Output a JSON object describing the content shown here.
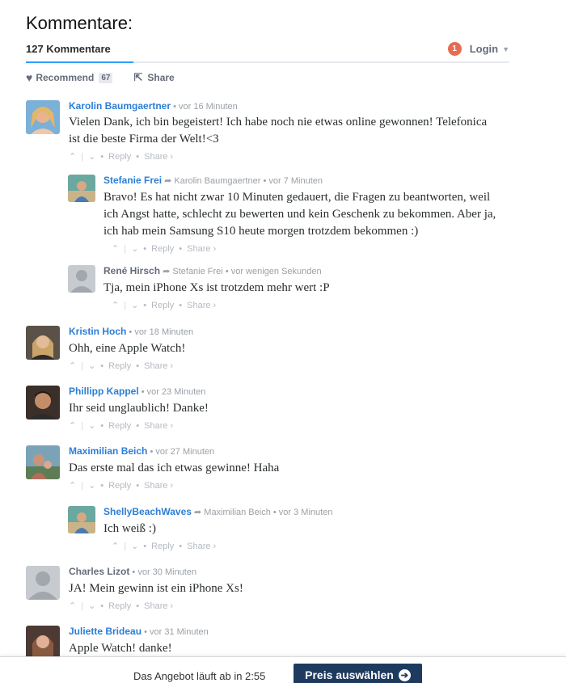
{
  "header": {
    "title": "Kommentare:",
    "count_label": "127 Kommentare",
    "notif_count": "1",
    "login_label": "Login",
    "recommend_label": "Recommend",
    "recommend_count": "67",
    "share_label": "Share"
  },
  "actions": {
    "reply": "Reply",
    "share": "Share ›",
    "up": "⌃",
    "down": "⌄"
  },
  "comments": [
    {
      "author": "Karolin Baumgaertner",
      "reply_to": "",
      "time": "• vor 16 Minuten",
      "line1": "Vielen Dank, ich bin begeistert! Ich habe noch nie etwas online gewonnen! Telefonica",
      "line2": "ist die beste Firma der Welt!<3",
      "line3": ""
    },
    {
      "author": "Stefanie Frei",
      "reply_to": "Karolin Baumgaertner",
      "time": "• vor 7 Minuten",
      "line1": "Bravo! Es hat nicht zwar 10 Minuten gedauert, die Fragen zu beantworten, weil",
      "line2": "ich Angst hatte, schlecht zu bewerten und kein Geschenk zu bekommen. Aber ja,",
      "line3": "ich hab mein Samsung S10 heute morgen trotzdem bekommen :)"
    },
    {
      "author": "René Hirsch",
      "reply_to": "Stefanie Frei",
      "time": "• vor wenigen Sekunden",
      "line1": "Tja, mein iPhone Xs ist trotzdem mehr wert :P",
      "line2": "",
      "line3": ""
    },
    {
      "author": "Kristin Hoch",
      "reply_to": "",
      "time": "• vor 18 Minuten",
      "line1": "Ohh, eine Apple Watch!",
      "line2": "",
      "line3": ""
    },
    {
      "author": "Phillipp Kappel",
      "reply_to": "",
      "time": "• vor 23 Minuten",
      "line1": "Ihr seid unglaublich! Danke!",
      "line2": "",
      "line3": ""
    },
    {
      "author": "Maximilian Beich",
      "reply_to": "",
      "time": "• vor 27 Minuten",
      "line1": "Das erste mal das ich etwas gewinne! Haha",
      "line2": "",
      "line3": ""
    },
    {
      "author": "ShellyBeachWaves",
      "reply_to": "Maximilian Beich",
      "time": "• vor 3 Minuten",
      "line1": "Ich weiß :)",
      "line2": "",
      "line3": ""
    },
    {
      "author": "Charles Lizot",
      "reply_to": "",
      "time": "• vor 30 Minuten",
      "line1": "JA! Mein gewinn ist ein iPhone Xs!",
      "line2": "",
      "line3": ""
    },
    {
      "author": "Juliette Brideau",
      "reply_to": "",
      "time": "• vor 31 Minuten",
      "line1": "Apple Watch! danke!",
      "line2": "",
      "line3": ""
    }
  ],
  "bottom": {
    "offer_text": "Das Angebot läuft ab in 2:55",
    "cta_label": "Preis auswählen"
  }
}
